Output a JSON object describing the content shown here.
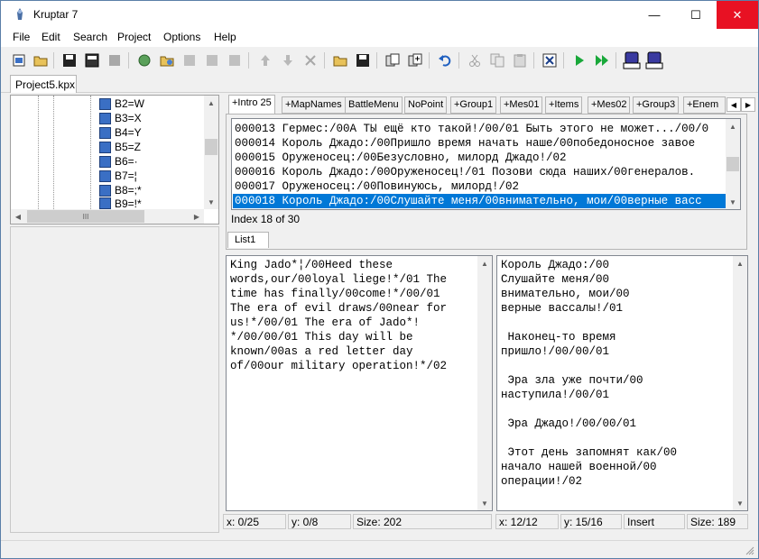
{
  "window": {
    "title": "Kruptar 7",
    "minimize": "—",
    "maximize": "☐",
    "close": "✕"
  },
  "menu": [
    "File",
    "Edit",
    "Search",
    "Project",
    "Options",
    "Help"
  ],
  "toolbar": {
    "icons": [
      "new-project-icon",
      "open-icon",
      "save-icon",
      "save-all-icon",
      "close-project-icon",
      "add-group-icon",
      "add-list-icon",
      "disabled-a-icon",
      "disabled-b-icon",
      "disabled-c-icon",
      "move-up-icon",
      "move-down-icon",
      "delete-icon",
      "open-file-icon",
      "save-file-icon",
      "disk-a-icon",
      "disk-b-icon",
      "undo-icon",
      "cut-icon",
      "copy-icon",
      "paste-icon",
      "clear-icon",
      "run-icon",
      "run-all-icon",
      "insert-icon",
      "output-icon"
    ],
    "colors": {
      "run": "#19a83a",
      "undo": "#2060c0",
      "accent": "#0078d7"
    }
  },
  "project_tab": "Project5.kpx",
  "tree": {
    "items": [
      "B2=W",
      "B3=X",
      "B4=Y",
      "B5=Z",
      "B6=·",
      "B7=¦",
      "B8=;*",
      "B9=!*"
    ],
    "scroll_label": "III"
  },
  "message_tabs": [
    "+Intro 25",
    "+MapNames",
    "BattleMenu",
    "NoPoint",
    "+Group1",
    "+Mes01",
    "+Items",
    "+Mes02",
    "+Group3",
    "+Enem"
  ],
  "list": {
    "rows": [
      "000013 Гермес:/00А ТЫ ещё кто такой!/00/01 Быть этого не может.../00/0",
      "000014 Король Джадо:/00Пришло время начать наше/00победоносное завое",
      "000015 Оруженосец:/00Безусловно, милорд Джадо!/02",
      "000016 Король Джадо:/00Оруженосец!/01 Позови сюда наших/00генералов.",
      "000017 Оруженосец:/00Повинуюсь, милорд!/02",
      "000018 Король Джадо:/00Слушайте меня/00внимательно, мои/00верные васс"
    ],
    "selected_index": 5,
    "index_text": "Index 18 of 30",
    "tab": "List1"
  },
  "left_editor": {
    "text": "King Jado*¦/00Heed these\nwords,our/00loyal liege!*/01 The\ntime has finally/00come!*/00/01\nThe era of evil draws/00near for\nus!*/00/01 The era of Jado*!\n*/00/00/01 This day will be\nknown/00as a red letter day\nof/00our military operation!*/02"
  },
  "right_editor": {
    "text": "Король Джадо:/00\nСлушайте меня/00\nвнимательно, мои/00\nверные вассалы!/01\n\n Наконец-то время\nпришло!/00/00/01\n\n Эра зла уже почти/00\nнаступила!/00/01\n\n Эра Джадо!/00/00/01\n\n Этот день запомнят как/00\nначало нашей военной/00\nоперации!/02"
  },
  "status_left": {
    "x": "x: 0/25",
    "y": "y: 0/8",
    "size": "Size: 202"
  },
  "status_right": {
    "x": "x: 12/12",
    "y": "y: 15/16",
    "mode": "Insert",
    "size": "Size: 189"
  }
}
